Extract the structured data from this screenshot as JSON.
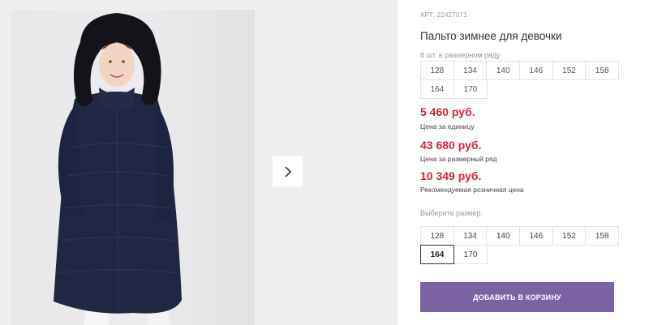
{
  "product": {
    "article": "АРТ: 22427071",
    "title": "Пальто зимнее для девочки",
    "image_alt": "Girl in navy winter coat with fur hood"
  },
  "gallery": {
    "next_icon": "chevron-right-icon"
  },
  "size_series": {
    "label": "8 шт. в размерном ряду",
    "sizes": [
      "128",
      "134",
      "140",
      "146",
      "152",
      "158",
      "164",
      "170"
    ]
  },
  "prices": {
    "unit_price": "5 460 руб.",
    "unit_caption": "Цена за единицу",
    "series_price": "43 680 руб.",
    "series_caption": "Цена за размерный ряд",
    "retail_price": "10 349 руб.",
    "retail_caption": "Рекомендуемая розничная цена",
    "price_color": "#d6213a"
  },
  "size_select": {
    "label": "Выберите размер:",
    "sizes": [
      "128",
      "134",
      "140",
      "146",
      "152",
      "158",
      "164",
      "170"
    ],
    "selected": "164"
  },
  "cart": {
    "add_label": "ДОБАВИТЬ В КОРЗИНУ",
    "button_color": "#7b62a3"
  }
}
